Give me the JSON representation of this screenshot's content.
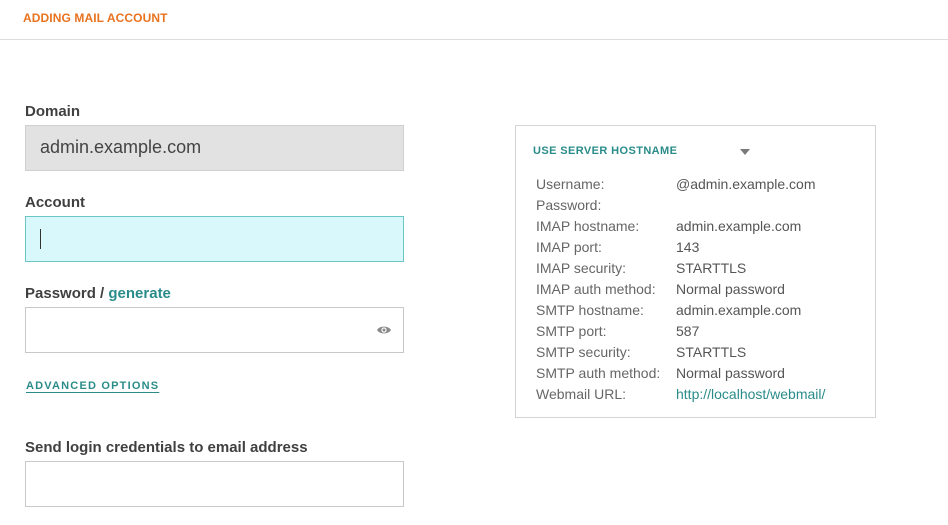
{
  "header": {
    "title": "ADDING MAIL ACCOUNT"
  },
  "form": {
    "domain": {
      "label": "Domain",
      "value": "admin.example.com"
    },
    "account": {
      "label": "Account",
      "value": ""
    },
    "password": {
      "label": "Password / ",
      "generate_link": "generate",
      "value": "",
      "icon": "eye-icon"
    },
    "advanced_options": "ADVANCED OPTIONS",
    "send_credentials": {
      "label": "Send login credentials to email address",
      "value": ""
    }
  },
  "info_panel": {
    "dropdown_label": "USE SERVER HOSTNAME",
    "rows": [
      {
        "key": "Username:",
        "value": "@admin.example.com"
      },
      {
        "key": "Password:",
        "value": ""
      },
      {
        "key": "IMAP hostname:",
        "value": "admin.example.com"
      },
      {
        "key": "IMAP port:",
        "value": "143"
      },
      {
        "key": "IMAP security:",
        "value": "STARTTLS"
      },
      {
        "key": "IMAP auth method:",
        "value": "Normal password"
      },
      {
        "key": "SMTP hostname:",
        "value": "admin.example.com"
      },
      {
        "key": "SMTP port:",
        "value": "587"
      },
      {
        "key": "SMTP security:",
        "value": "STARTTLS"
      },
      {
        "key": "SMTP auth method:",
        "value": "Normal password"
      },
      {
        "key": "Webmail URL:",
        "value": "http://localhost/webmail/"
      }
    ]
  },
  "colors": {
    "accent_orange": "#e8731f",
    "accent_teal": "#2a8c8a",
    "focus_bg": "#d8f8fc"
  }
}
